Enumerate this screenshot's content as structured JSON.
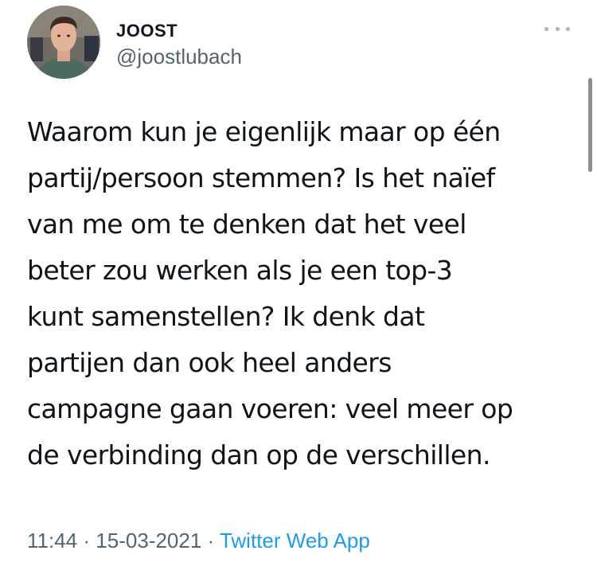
{
  "author": {
    "name": "JOOST",
    "handle": "@joostlubach",
    "avatar": "avatar-photo"
  },
  "more_menu": {
    "icon": "more-horizontal-icon"
  },
  "tweet": {
    "lines": [
      "Waarom kun je eigenlijk maar op één",
      "partij/persoon stemmen? Is het naïef",
      "van me om te denken dat het veel",
      "beter zou werken als je een top-3",
      "kunt samenstellen? Ik denk dat",
      "partijen dan ook heel anders",
      "campagne gaan voeren: veel meer op",
      "de verbinding dan op de verschillen."
    ]
  },
  "meta": {
    "time": "11:44",
    "separator": "·",
    "date": "15-03-2021",
    "source": "Twitter Web App"
  },
  "colors": {
    "text": "#0f1419",
    "secondary": "#536471",
    "link": "#1d9bf0"
  }
}
